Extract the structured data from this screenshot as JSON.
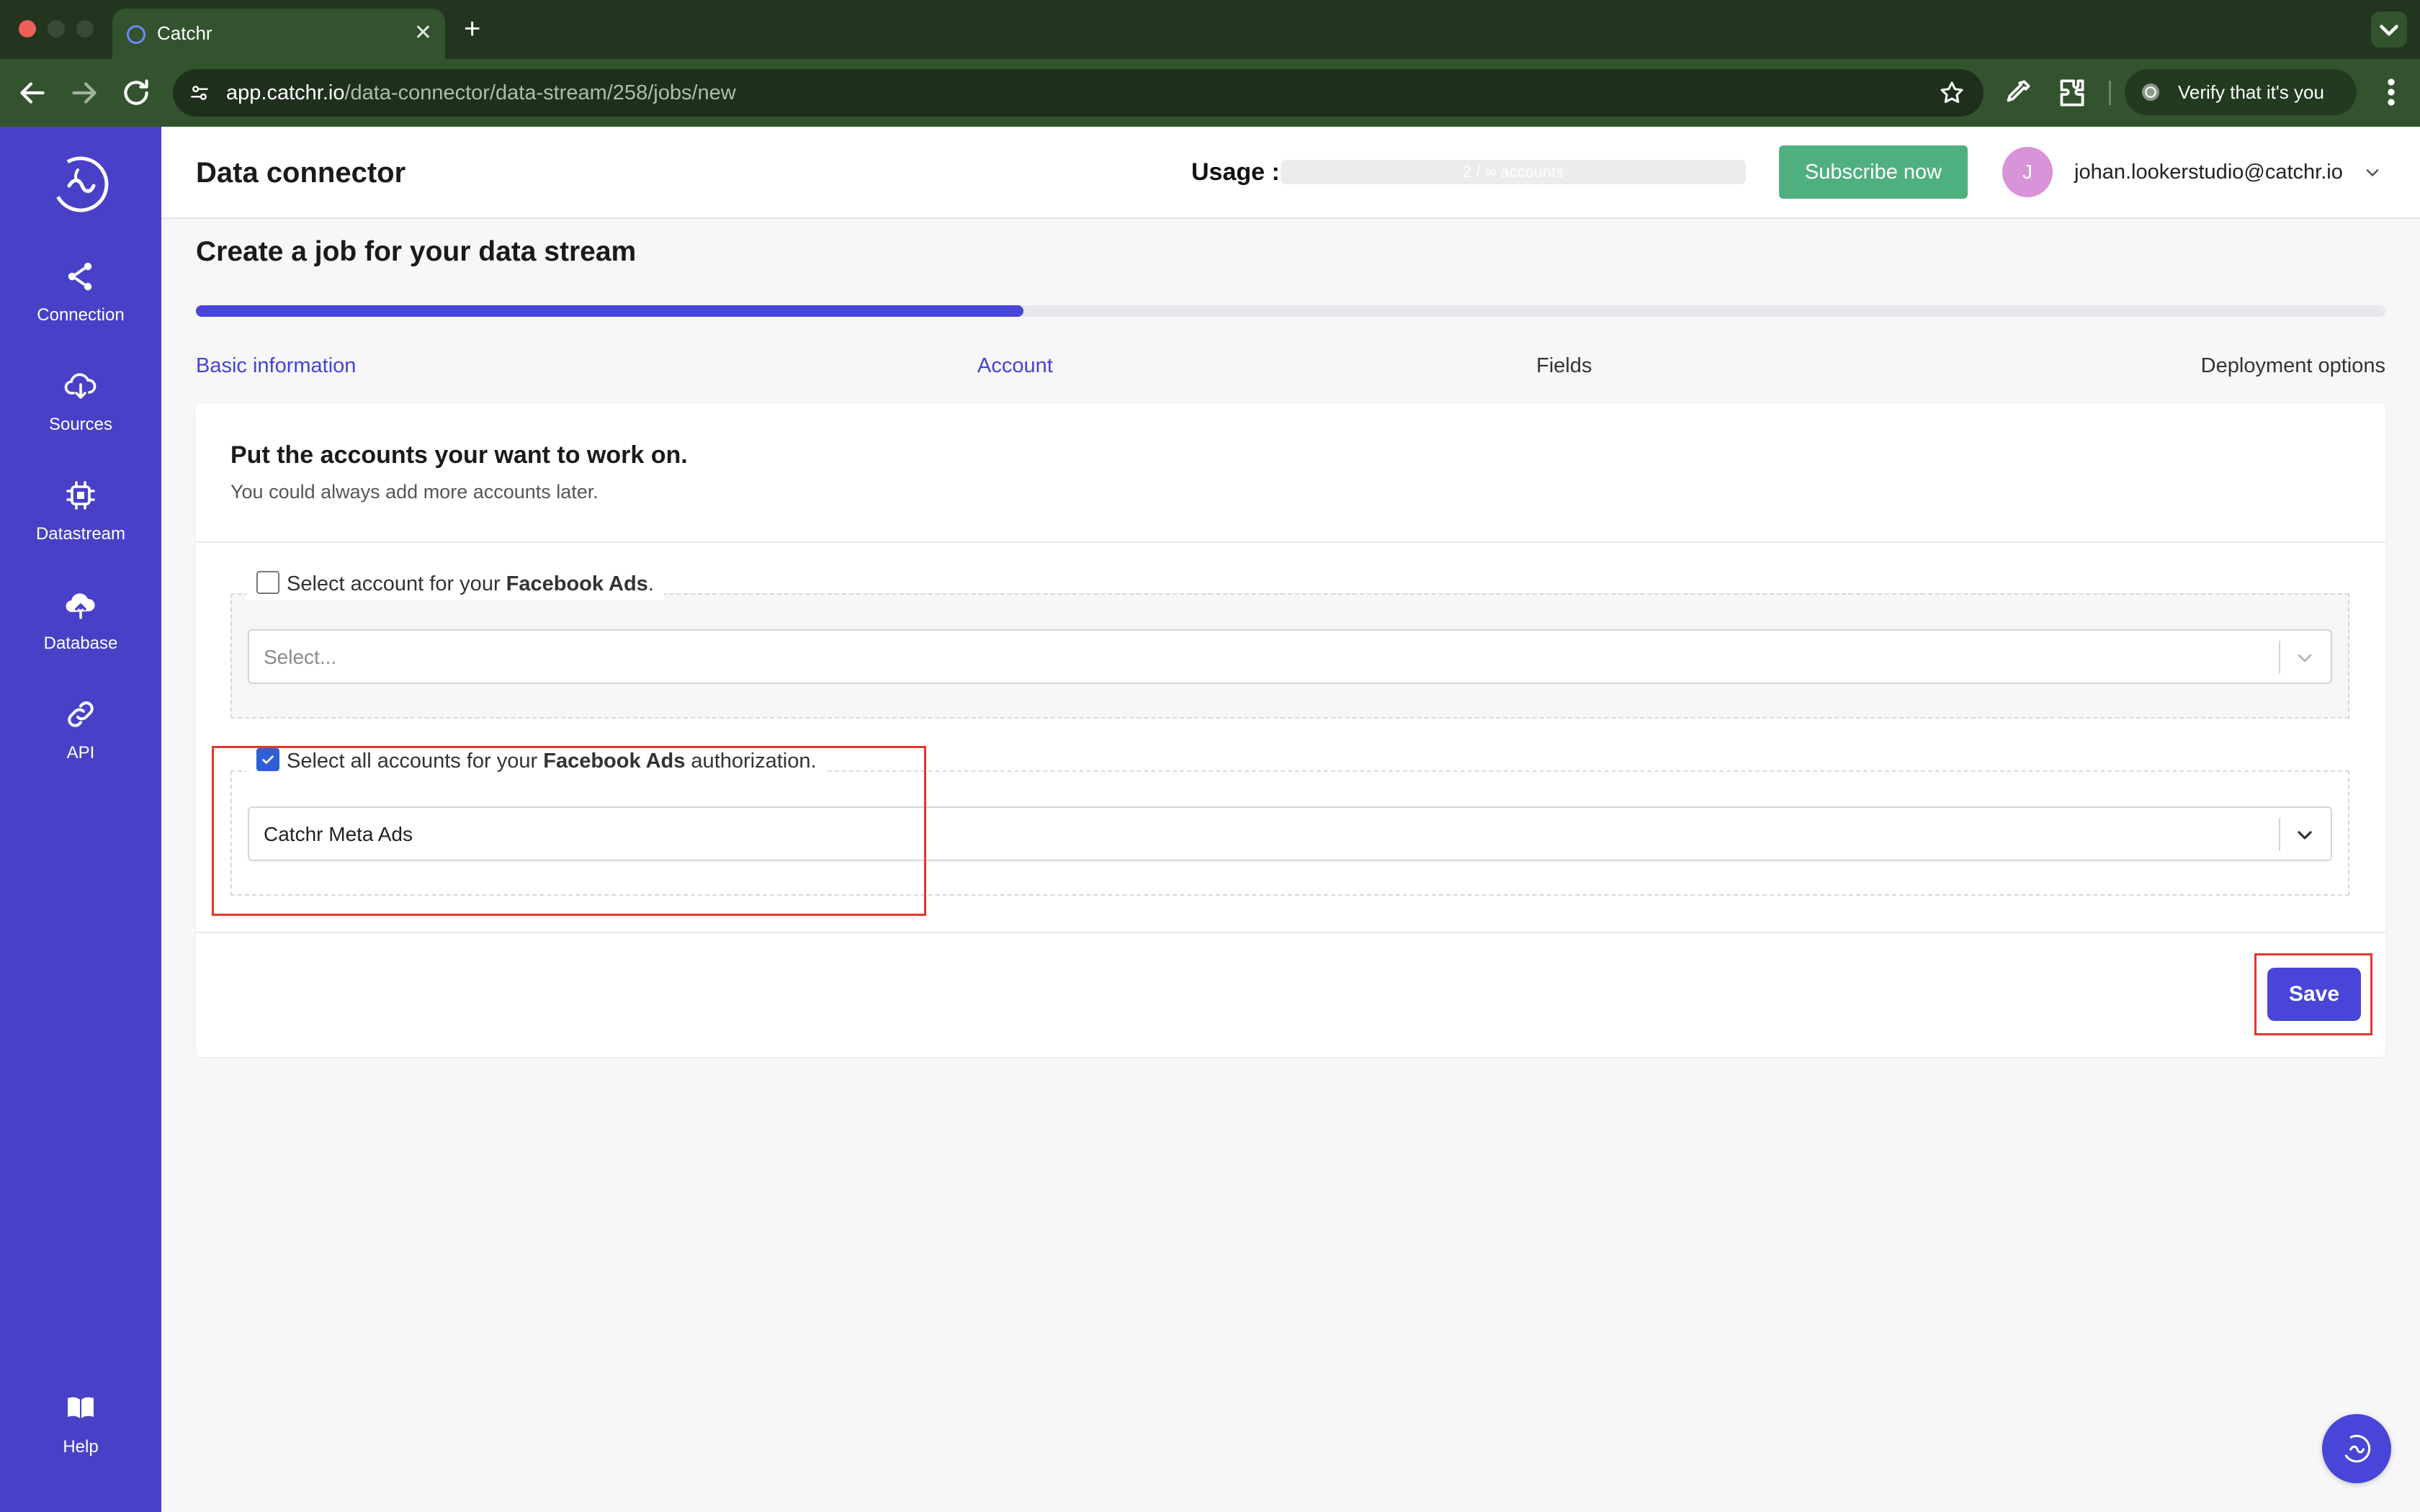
{
  "browser": {
    "tab_title": "Catchr",
    "tab_close": "✕",
    "new_tab": "+",
    "url_host": "app.catchr.io",
    "url_path": "/data-connector/data-stream/258/jobs/new",
    "verify_text": "Verify that it's you"
  },
  "sidebar": {
    "items": [
      {
        "label": "Connection",
        "icon": "share-icon"
      },
      {
        "label": "Sources",
        "icon": "cloud-download-icon"
      },
      {
        "label": "Datastream",
        "icon": "cpu-chip-icon"
      },
      {
        "label": "Database",
        "icon": "cloud-upload-icon"
      },
      {
        "label": "API",
        "icon": "link-icon"
      }
    ],
    "help_label": "Help"
  },
  "header": {
    "title": "Data connector",
    "usage_label": "Usage :",
    "usage_text": "2 / ∞ accounts",
    "subscribe_label": "Subscribe now",
    "avatar_initial": "J",
    "user_email": "johan.lookerstudio@catchr.io"
  },
  "page": {
    "title": "Create a job for your data stream",
    "progress_percent": 37.8,
    "steps": [
      {
        "label": "Basic information",
        "state": "done"
      },
      {
        "label": "Account",
        "state": "active"
      },
      {
        "label": "Fields",
        "state": "pending"
      },
      {
        "label": "Deployment options",
        "state": "pending"
      }
    ]
  },
  "card": {
    "heading": "Put the accounts your want to work on.",
    "subheading": "You could always add more accounts later.",
    "section1": {
      "checked": false,
      "label_prefix": "Select account for your ",
      "label_bold": "Facebook Ads",
      "label_suffix": ".",
      "placeholder": "Select..."
    },
    "section2": {
      "checked": true,
      "label_prefix": "Select all accounts for your ",
      "label_bold": "Facebook Ads",
      "label_suffix": " authorization.",
      "value": "Catchr Meta Ads"
    },
    "save_label": "Save"
  },
  "colors": {
    "sidebar": "#4841c8",
    "accent": "#4845d8",
    "subscribe": "#4fb07f",
    "highlight": "#e0382b",
    "browser_chrome": "#33522e"
  }
}
